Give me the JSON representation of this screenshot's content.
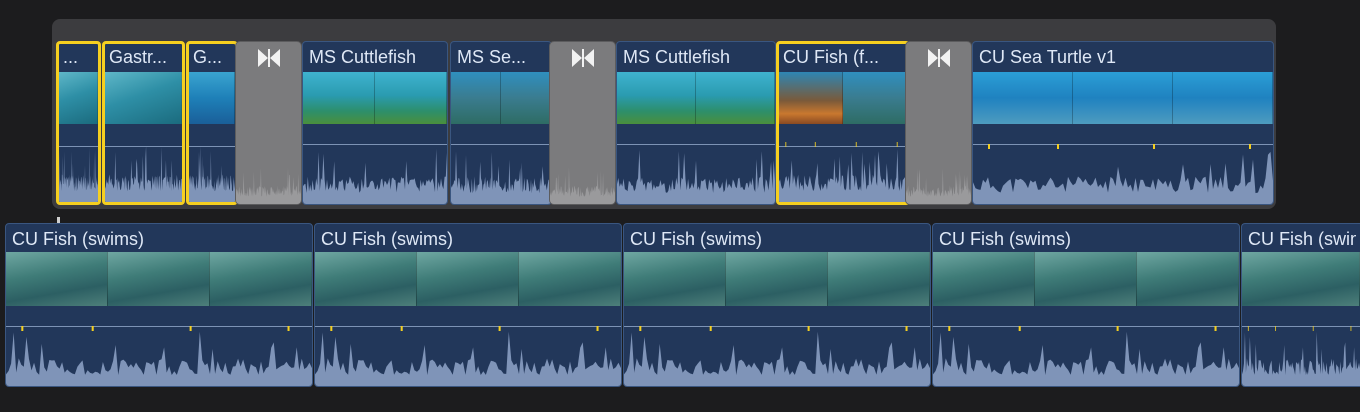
{
  "colors": {
    "clip_fill": "#22375a",
    "selection": "#f5cf20",
    "transition": "#7b7b7d",
    "waveform": "#7f94b8",
    "background": "#1c1c1e",
    "storyline": "#3c3c3f"
  },
  "primary_storyline": {
    "clips": [
      {
        "label": "...",
        "selected": true,
        "thumb": "shallow"
      },
      {
        "label": "Gastr...",
        "selected": true,
        "thumb": "shallow"
      },
      {
        "label": "G...",
        "selected": true,
        "thumb": "blue"
      },
      {
        "label": "MS Cuttlefish",
        "selected": false,
        "thumb": "cuttle"
      },
      {
        "label": "MS Se...",
        "selected": false,
        "thumb": "reef"
      },
      {
        "label": "MS Cuttlefish",
        "selected": false,
        "thumb": "cuttle"
      },
      {
        "label": "CU Fish (f...",
        "selected": true,
        "thumb": "orange"
      },
      {
        "label": "CU Sea Turtle v1",
        "selected": false,
        "thumb": "turtle"
      }
    ],
    "transitions": [
      {
        "icon": "bowtie-transition-icon"
      },
      {
        "icon": "bowtie-transition-icon"
      },
      {
        "icon": "bowtie-transition-icon"
      }
    ]
  },
  "connected_clips": [
    {
      "label": "CU Fish (swims)"
    },
    {
      "label": "CU Fish (swims)"
    },
    {
      "label": "CU Fish (swims)"
    },
    {
      "label": "CU Fish (swims)"
    },
    {
      "label": "CU Fish (swims)"
    }
  ]
}
